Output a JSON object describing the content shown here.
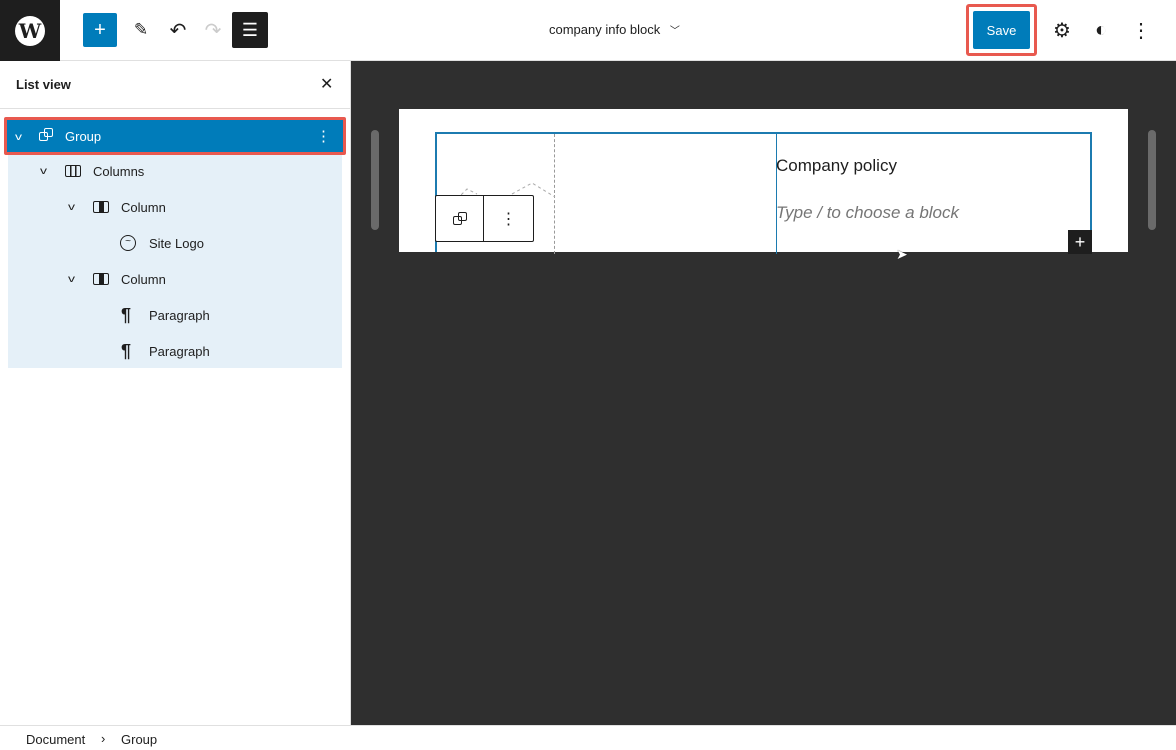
{
  "header": {
    "title": "company info block",
    "save_label": "Save"
  },
  "list_view": {
    "title": "List view",
    "items": [
      {
        "label": "Group",
        "icon": "group-icon"
      },
      {
        "label": "Columns",
        "icon": "columns-icon"
      },
      {
        "label": "Column",
        "icon": "column-icon"
      },
      {
        "label": "Site Logo",
        "icon": "site-logo-icon"
      },
      {
        "label": "Column",
        "icon": "column-icon"
      },
      {
        "label": "Paragraph",
        "icon": "paragraph-icon"
      },
      {
        "label": "Paragraph",
        "icon": "paragraph-icon"
      }
    ]
  },
  "canvas": {
    "heading": "Company policy",
    "placeholder": "Type / to choose a block"
  },
  "breadcrumb": {
    "items": [
      "Document",
      "Group"
    ]
  },
  "colors": {
    "accent": "#007cba",
    "highlight": "#e8594f",
    "canvas": "#2f2f2f"
  }
}
